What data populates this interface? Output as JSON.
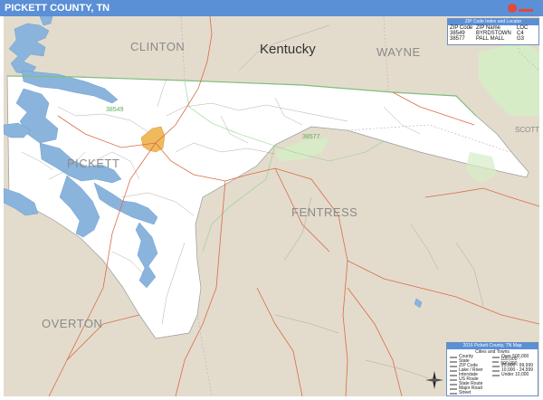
{
  "title": "PICKETT COUNTY, TN",
  "map_labels": {
    "kentucky": "Kentucky",
    "clinton": "CLINTON",
    "wayne": "WAYNE",
    "scott": "SCOTT",
    "pickett": "PICKETT",
    "fentress": "FENTRESS",
    "overton": "OVERTON",
    "zip_38549": "38549",
    "zip_38577": "38577"
  },
  "zip_locator": {
    "heading": "ZIP Code Index and Locator",
    "columns": [
      "ZIP Code",
      "ZIP Name",
      "LOC"
    ],
    "rows": [
      [
        "38549",
        "BYRDSTOWN",
        "C4"
      ],
      [
        "38577",
        "PALL MALL",
        "G3"
      ]
    ]
  },
  "legend": {
    "heading": "2016 Pickett County, TN Map",
    "subheading": "Cities and Towns",
    "left_items": [
      "County",
      "State",
      "ZIP Code",
      "Lake / River",
      "Interstate",
      "US Route",
      "State Route",
      "Major Road",
      "Street"
    ],
    "right_items": [
      "Over 500,000",
      "100,000 - 500,000",
      "25,000 - 99,999",
      "10,000 - 24,999",
      "Under 10,000"
    ]
  },
  "colors": {
    "title_bar": "#5b8fd6",
    "land_outside": "#e3dccc",
    "county_fill": "#ffffff",
    "water": "#8ab4dc",
    "park": "#d6ecc6",
    "town": "#f0b95b",
    "road_major": "#d96a4a",
    "road_minor": "#8a8a8a"
  }
}
